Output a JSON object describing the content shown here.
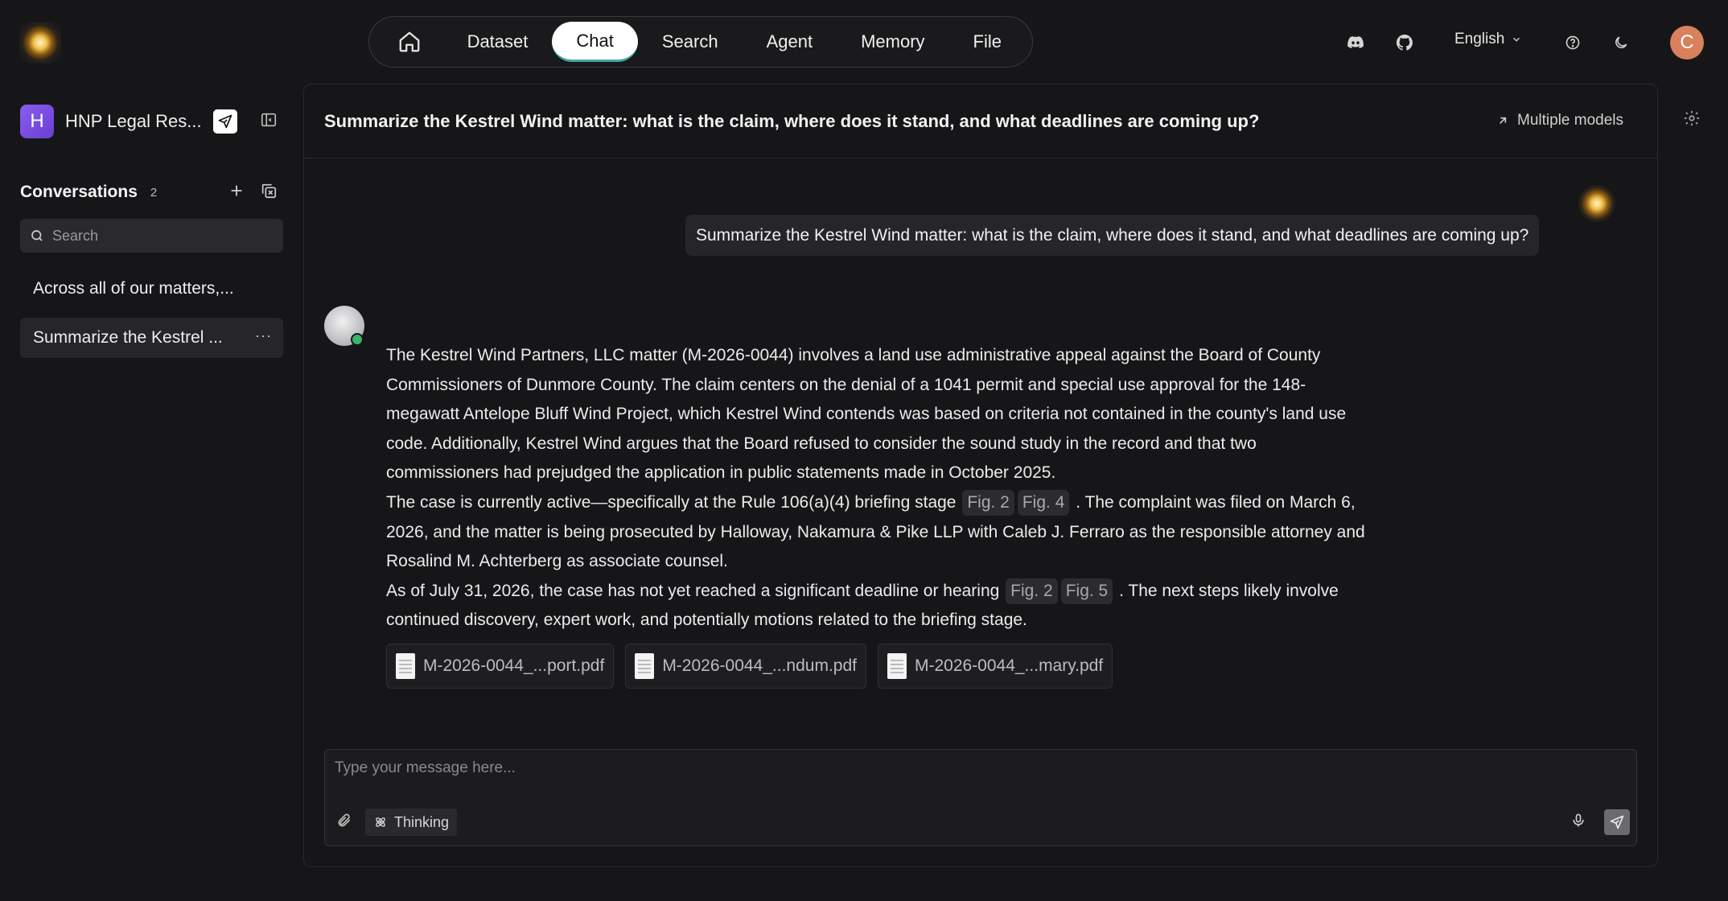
{
  "app": {
    "logo_icon": "sun-orb-logo"
  },
  "nav": {
    "home_icon": "home-icon",
    "tabs": [
      "Dataset",
      "Chat",
      "Search",
      "Agent",
      "Memory",
      "File"
    ],
    "active_tab": "Chat",
    "accent_color": "#3fa9a2"
  },
  "topright": {
    "icons": [
      "discord-icon",
      "github-icon",
      "help-icon",
      "moon-icon"
    ],
    "language": "English",
    "user_initial": "C",
    "user_avatar_color": "#d9805c"
  },
  "sidebar": {
    "kb_initial": "H",
    "kb_name": "HNP Legal Res...",
    "conversations_title": "Conversations",
    "conversations_count": "2",
    "search_placeholder": "Search",
    "items": [
      {
        "label": "Across all of our matters,...",
        "active": false
      },
      {
        "label": "Summarize the Kestrel ...",
        "active": true,
        "more": "···"
      }
    ]
  },
  "chat": {
    "title": "Summarize the Kestrel Wind matter: what is the claim, where does it stand, and what deadlines are coming up?",
    "multiple_models_label": "Multiple models",
    "user_message": "Summarize the Kestrel Wind matter: what is the claim, where does it stand, and what deadlines are coming up?",
    "answer": {
      "p1": "The Kestrel Wind Partners, LLC matter (M-2026-0044) involves a land use administrative appeal against the Board of County Commissioners of Dunmore County. The claim centers on the denial of a 1041 permit and special use approval for the 148-megawatt Antelope Bluff Wind Project, which Kestrel Wind contends was based on criteria not contained in the county's land use code. Additionally, Kestrel Wind argues that the Board refused to consider the sound study in the record and that two commissioners had prejudged the application in public statements made in October 2025.",
      "p2_a": "The case is currently active—specifically at the Rule 106(a)(4) briefing stage",
      "p2_refs": [
        "Fig. 2",
        "Fig. 4"
      ],
      "p2_b": ". The complaint was filed on March 6, 2026, and the matter is being prosecuted by Halloway, Nakamura & Pike LLP with Caleb J. Ferraro as the responsible attorney and Rosalind M. Achterberg as associate counsel.",
      "p3_a": "As of July 31, 2026, the case has not yet reached a significant deadline or hearing",
      "p3_refs": [
        "Fig. 2",
        "Fig. 5"
      ],
      "p3_b": ". The next steps likely involve continued discovery, expert work, and potentially motions related to the briefing stage."
    },
    "documents": [
      "M-2026-0044_...port.pdf",
      "M-2026-0044_...ndum.pdf",
      "M-2026-0044_...mary.pdf"
    ]
  },
  "composer": {
    "placeholder": "Type your message here...",
    "thinking_label": "Thinking"
  }
}
